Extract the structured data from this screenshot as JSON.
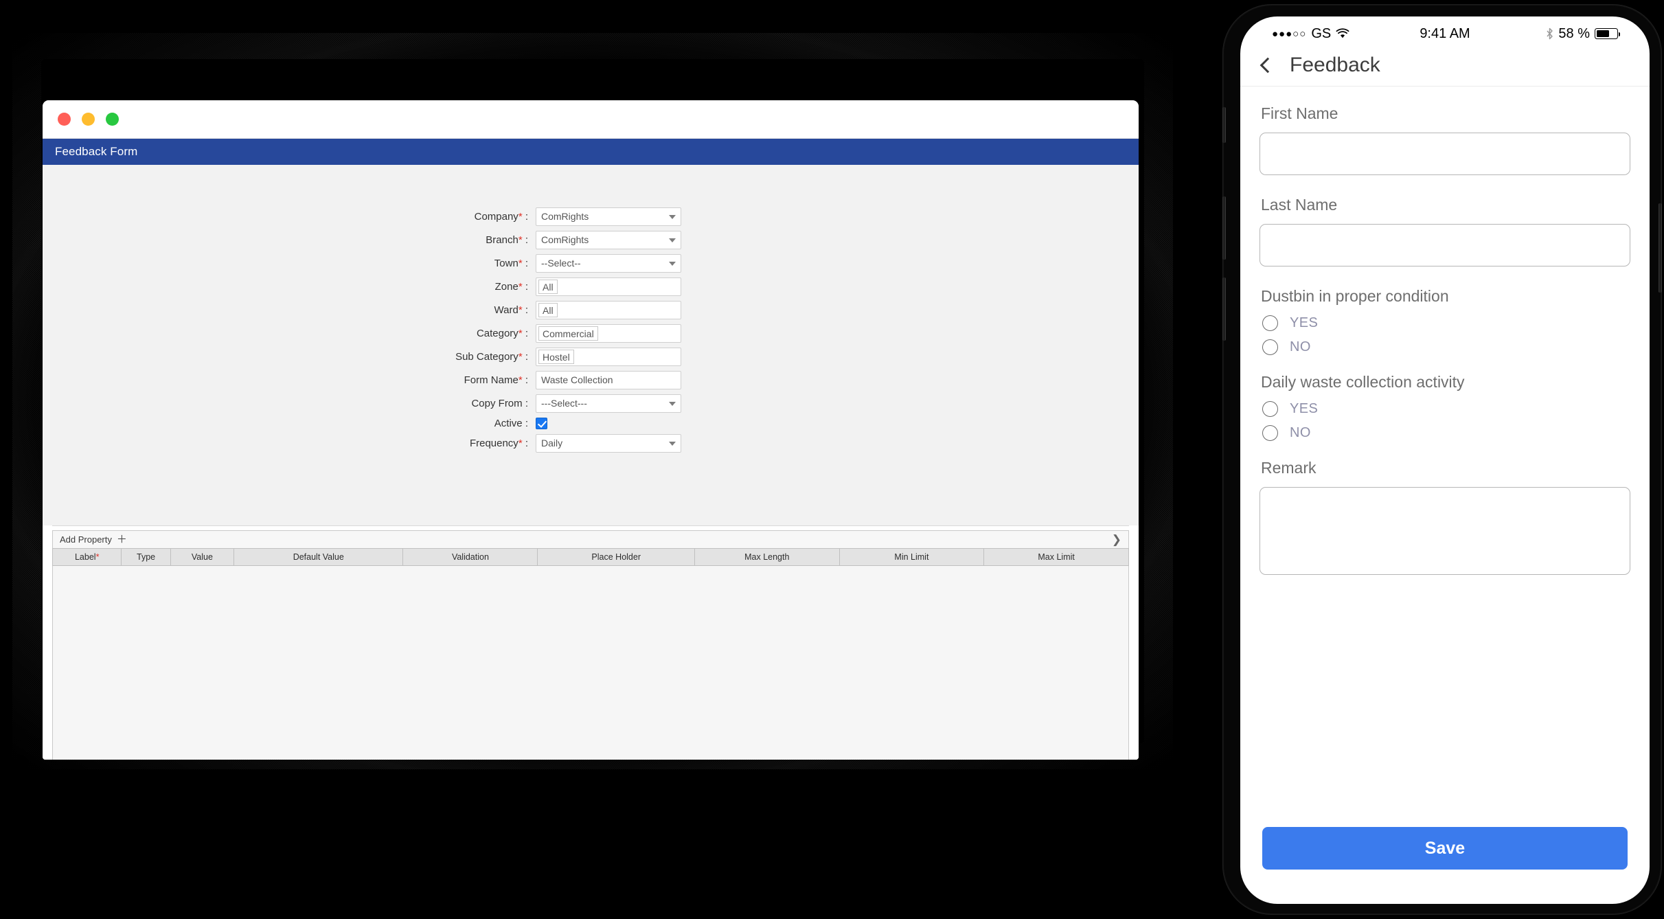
{
  "desktop": {
    "window_controls": {
      "close": "close",
      "minimize": "minimize",
      "zoom": "zoom"
    },
    "app_header_title": "Feedback Form",
    "header_color": "#27489b",
    "form_fields": [
      {
        "label": "Company",
        "required": true,
        "type": "select",
        "value": "ComRights"
      },
      {
        "label": "Branch",
        "required": true,
        "type": "select",
        "value": "ComRights"
      },
      {
        "label": "Town",
        "required": true,
        "type": "select",
        "value": "--Select--"
      },
      {
        "label": "Zone",
        "required": true,
        "type": "boxtext",
        "value": "All"
      },
      {
        "label": "Ward",
        "required": true,
        "type": "boxtext",
        "value": "All"
      },
      {
        "label": "Category",
        "required": true,
        "type": "boxtext",
        "value": "Commercial"
      },
      {
        "label": "Sub Category",
        "required": true,
        "type": "boxtext",
        "value": "Hostel"
      },
      {
        "label": "Form Name",
        "required": true,
        "type": "text",
        "value": "Waste Collection"
      },
      {
        "label": "Copy From",
        "required": false,
        "type": "select",
        "value": "---Select---"
      },
      {
        "label": "Active",
        "required": false,
        "type": "checkbox",
        "value": "checked"
      },
      {
        "label": "Frequency",
        "required": true,
        "type": "select",
        "value": "Daily"
      }
    ],
    "grid": {
      "add_property_label": "Add Property",
      "add_property_icon": "plus-icon",
      "expand_icon": "chevron-right-icon",
      "columns": [
        {
          "label": "Label",
          "required": true
        },
        {
          "label": "Type",
          "required": false
        },
        {
          "label": "Value",
          "required": false
        },
        {
          "label": "Default Value",
          "required": false
        },
        {
          "label": "Validation",
          "required": false
        },
        {
          "label": "Place Holder",
          "required": false
        },
        {
          "label": "Max Length",
          "required": false
        },
        {
          "label": "Min Limit",
          "required": false
        },
        {
          "label": "Max Limit",
          "required": false
        }
      ],
      "rows": []
    }
  },
  "phone": {
    "statusbar": {
      "signal_dots": "●●●○○",
      "carrier": "GS",
      "wifi_icon": "wifi-icon",
      "time": "9:41 AM",
      "bluetooth_icon": "bluetooth-icon",
      "battery_percent": "58 %",
      "battery_icon": "battery-icon"
    },
    "navbar": {
      "back_icon": "chevron-left-icon",
      "title": "Feedback"
    },
    "form": [
      {
        "kind": "input",
        "label": "First Name",
        "value": "",
        "placeholder": ""
      },
      {
        "kind": "input",
        "label": "Last Name",
        "value": "",
        "placeholder": ""
      },
      {
        "kind": "radio",
        "label": "Dustbin in proper condition",
        "options": [
          "YES",
          "NO"
        ],
        "selected": ""
      },
      {
        "kind": "radio",
        "label": "Daily waste collection activity",
        "options": [
          "YES",
          "NO"
        ],
        "selected": ""
      },
      {
        "kind": "textarea",
        "label": "Remark",
        "value": "",
        "placeholder": ""
      }
    ],
    "save_label": "Save",
    "save_color": "#3b7bed"
  }
}
